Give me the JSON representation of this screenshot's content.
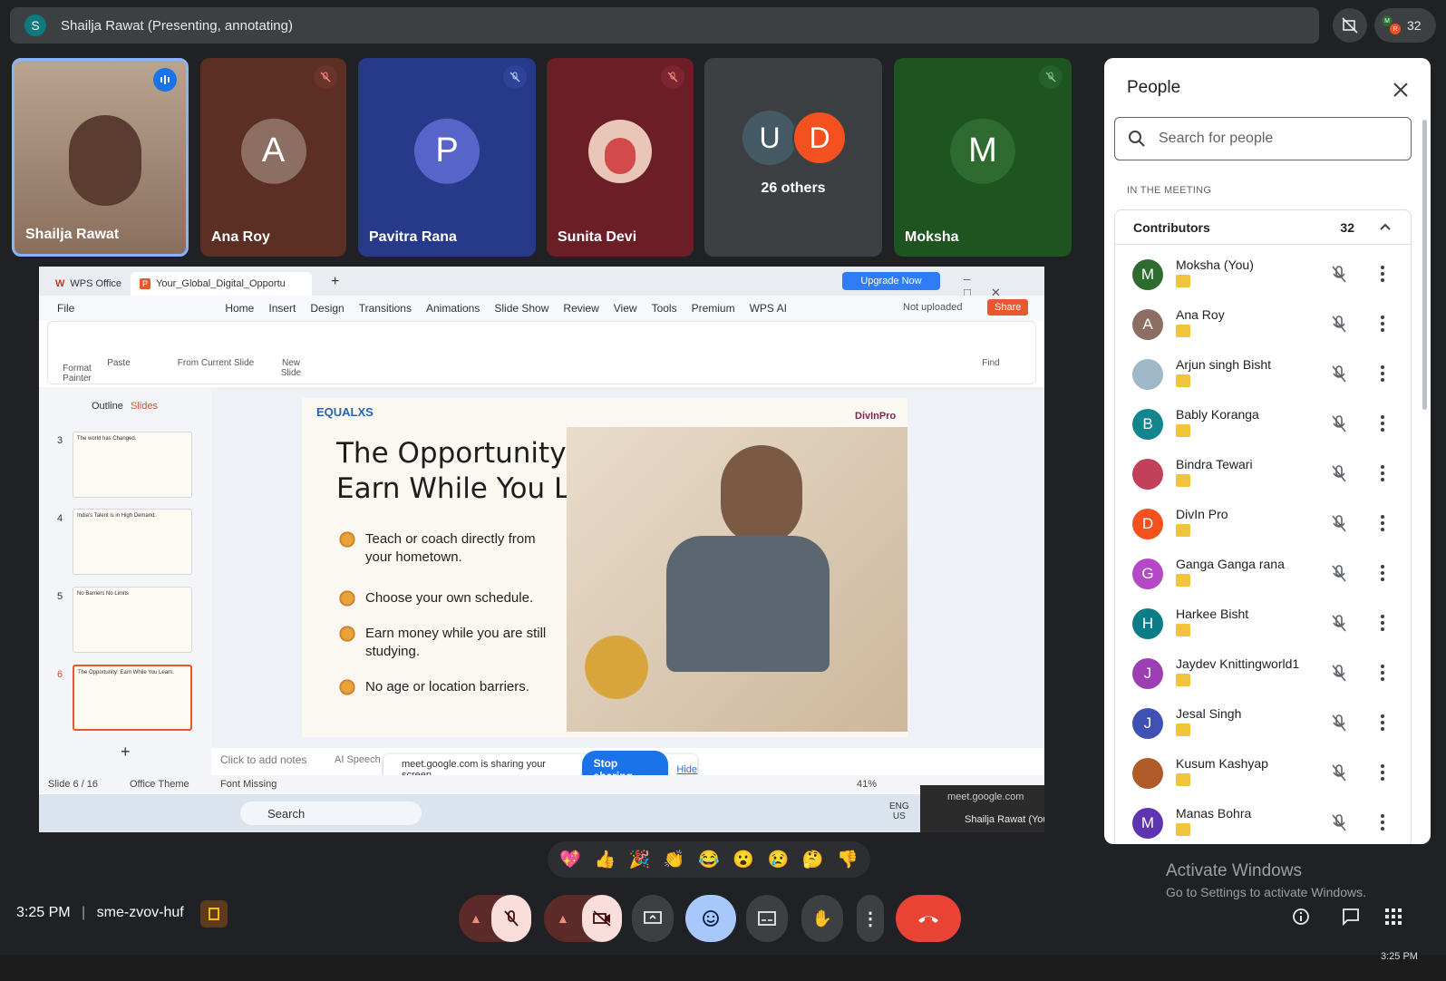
{
  "presenter_bar": {
    "avatar_letter": "S",
    "text": "Shailja Rawat (Presenting, annotating)"
  },
  "participant_count": "32",
  "chip_mini": [
    "M",
    "R"
  ],
  "tiles": [
    {
      "name": "Shailja Rawat",
      "letter": "",
      "color": "#7a5a44"
    },
    {
      "name": "Ana Roy",
      "letter": "A",
      "color": "#6d3a2e"
    },
    {
      "name": "Pavitra Rana",
      "letter": "P",
      "color": "#2b3a8c"
    },
    {
      "name": "Sunita Devi",
      "letter": "",
      "color": "#6b1f26"
    },
    {
      "name": "26 others",
      "letter": "",
      "color": "#3c4043"
    },
    {
      "name": "Moksha",
      "letter": "M",
      "color": "#1e5a22"
    }
  ],
  "others_avatars": [
    "U",
    "D"
  ],
  "people": {
    "title": "People",
    "search_placeholder": "Search for people",
    "section": "IN THE MEETING",
    "group_label": "Contributors",
    "group_count": "32",
    "list": [
      {
        "name": "Moksha (You)",
        "letter": "M",
        "color": "#2e6b30"
      },
      {
        "name": "Ana Roy",
        "letter": "A",
        "color": "#8d6e63"
      },
      {
        "name": "Arjun singh Bisht",
        "letter": "",
        "color": "#9fb8c8"
      },
      {
        "name": "Bably Koranga",
        "letter": "B",
        "color": "#12858f"
      },
      {
        "name": "Bindra Tewari",
        "letter": "",
        "color": "#c2405a"
      },
      {
        "name": "DivIn Pro",
        "letter": "D",
        "color": "#f4511e"
      },
      {
        "name": "Ganga Ganga rana",
        "letter": "G",
        "color": "#b548c6"
      },
      {
        "name": "Harkee Bisht",
        "letter": "H",
        "color": "#0b7d86"
      },
      {
        "name": "Jaydev Knittingworld1",
        "letter": "J",
        "color": "#9c3fb5"
      },
      {
        "name": "Jesal Singh",
        "letter": "J",
        "color": "#3f51b5"
      },
      {
        "name": "Kusum Kashyap",
        "letter": "",
        "color": "#b05a2a"
      },
      {
        "name": "Manas Bohra",
        "letter": "M",
        "color": "#5e35b1"
      }
    ]
  },
  "wps": {
    "tab_office": "WPS Office",
    "tab_doc": "Your_Global_Digital_Opportu",
    "upgrade": "Upgrade Now",
    "menu": [
      "File",
      "Home",
      "Insert",
      "Design",
      "Transitions",
      "Animations",
      "Slide Show",
      "Review",
      "View",
      "Tools",
      "Premium",
      "WPS AI"
    ],
    "not_uploaded": "Not uploaded",
    "share": "Share",
    "ribbon": {
      "format_painter": "Format Painter",
      "paste": "Paste",
      "from_current": "From Current Slide",
      "new_slide": "New Slide",
      "find": "Find"
    },
    "panel_tabs": [
      "Outline",
      "Slides"
    ],
    "slide_numbers": [
      "3",
      "4",
      "5",
      "6"
    ],
    "thumb_titles": [
      "The world has Changed.",
      "India's Talent is in High Demand.",
      "No Barriers No Limits",
      "The Opportunity: Earn While You Learn."
    ],
    "notes_placeholder": "Click to add notes",
    "ai_speech": "AI Speech",
    "status": {
      "slide": "Slide 6 / 16",
      "theme": "Office Theme",
      "font": "Font Missing",
      "zoom": "41%"
    },
    "slide": {
      "logo_left": "EQUALXS",
      "logo_right": "DivInPro",
      "title_line1": "The Opportunity:",
      "title_line2": "Earn While You Learn.",
      "bullets": [
        "Teach or coach directly from your hometown.",
        "Choose your own schedule.",
        "Earn money while you are still studying.",
        "No age or location barriers."
      ]
    },
    "sharing": {
      "text": "meet.google.com is sharing your screen.",
      "stop": "Stop sharing",
      "hide": "Hide"
    },
    "taskbar_search": "Search",
    "lang": "ENG\nUS",
    "popup_url": "meet.google.com",
    "popup_item": "Shailja Rawat (You"
  },
  "reactions": [
    "💖",
    "👍",
    "🎉",
    "👏",
    "😂",
    "😮",
    "😢",
    "🤔",
    "👎"
  ],
  "meeting": {
    "time": "3:25 PM",
    "code": "sme-zvov-huf"
  },
  "activate": {
    "line1": "Activate Windows",
    "line2": "Go to Settings to activate Windows."
  },
  "clock": "3:25 PM",
  "colors": {
    "end_call": "#ea4335",
    "accent_blue": "#1a73e8",
    "muted_red": "#f9dedc"
  }
}
